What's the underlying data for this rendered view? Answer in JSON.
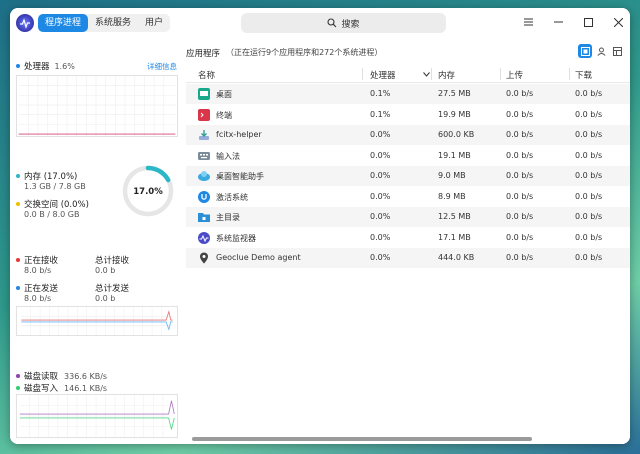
{
  "header": {
    "tabs": [
      {
        "label": "程序进程",
        "active": true
      },
      {
        "label": "系统服务",
        "active": false
      },
      {
        "label": "用户",
        "active": false
      }
    ],
    "search_label": "搜索"
  },
  "left": {
    "cpu": {
      "label": "处理器",
      "value": "1.6%",
      "details_link": "详细信息"
    },
    "memory": {
      "label": "内存 (17.0%)",
      "value": "1.3 GB / 7.8 GB",
      "ring_label": "17.0%",
      "ring_fraction": 0.17
    },
    "swap": {
      "label": "交换空间 (0.0%)",
      "value": "0.0 B / 8.0 GB"
    },
    "network": {
      "recv_label": "正在接收",
      "recv_value": "8.0 b/s",
      "total_recv_label": "总计接收",
      "total_recv_value": "0.0 b",
      "send_label": "正在发送",
      "send_value": "8.0 b/s",
      "total_send_label": "总计发送",
      "total_send_value": "0.0 b"
    },
    "disk": {
      "read_label": "磁盘读取",
      "read_value": "336.6 KB/s",
      "write_label": "磁盘写入",
      "write_value": "146.1 KB/s"
    }
  },
  "right": {
    "title": "应用程序",
    "subtitle": "（正在运行9个应用程序和272个系统进程）",
    "columns": [
      "名称",
      "处理器",
      "内存",
      "上传",
      "下载"
    ],
    "rows": [
      {
        "name": "桌面",
        "cpu": "0.1%",
        "mem": "27.5 MB",
        "up": "0.0 b/s",
        "down": "0.0 b/s",
        "icon": "desktop-icon",
        "color": "#1aa88a"
      },
      {
        "name": "终端",
        "cpu": "0.1%",
        "mem": "19.9 MB",
        "up": "0.0 b/s",
        "down": "0.0 b/s",
        "icon": "terminal-icon",
        "color": "#d9364a"
      },
      {
        "name": "fcitx-helper",
        "cpu": "0.0%",
        "mem": "600.0 KB",
        "up": "0.0 b/s",
        "down": "0.0 b/s",
        "icon": "install-icon",
        "color": "#2aa198"
      },
      {
        "name": "输入法",
        "cpu": "0.0%",
        "mem": "19.1 MB",
        "up": "0.0 b/s",
        "down": "0.0 b/s",
        "icon": "keyboard-icon",
        "color": "#7a8a99"
      },
      {
        "name": "桌面智能助手",
        "cpu": "0.0%",
        "mem": "9.0 MB",
        "up": "0.0 b/s",
        "down": "0.0 b/s",
        "icon": "assistant-icon",
        "color": "#39a9e0"
      },
      {
        "name": "激活系统",
        "cpu": "0.0%",
        "mem": "8.9 MB",
        "up": "0.0 b/s",
        "down": "0.0 b/s",
        "icon": "activation-icon",
        "color": "#1e88e5"
      },
      {
        "name": "主目录",
        "cpu": "0.0%",
        "mem": "12.5 MB",
        "up": "0.0 b/s",
        "down": "0.0 b/s",
        "icon": "home-folder-icon",
        "color": "#2b8fd8"
      },
      {
        "name": "系统监视器",
        "cpu": "0.0%",
        "mem": "17.1 MB",
        "up": "0.0 b/s",
        "down": "0.0 b/s",
        "icon": "system-monitor-icon",
        "color": "#4a4ac8"
      },
      {
        "name": "Geoclue Demo agent",
        "cpu": "0.0%",
        "mem": "444.0 KB",
        "up": "0.0 b/s",
        "down": "0.0 b/s",
        "icon": "location-pin-icon",
        "color": "#444444"
      }
    ]
  },
  "colors": {
    "accent": "#1e88e5",
    "cpu": "#1e88e5",
    "memory": "#2ab7c8",
    "swap": "#f0c000",
    "recv": "#e53935",
    "send": "#1e88e5",
    "disk_read": "#8e44ad",
    "disk_write": "#2ecc71"
  }
}
